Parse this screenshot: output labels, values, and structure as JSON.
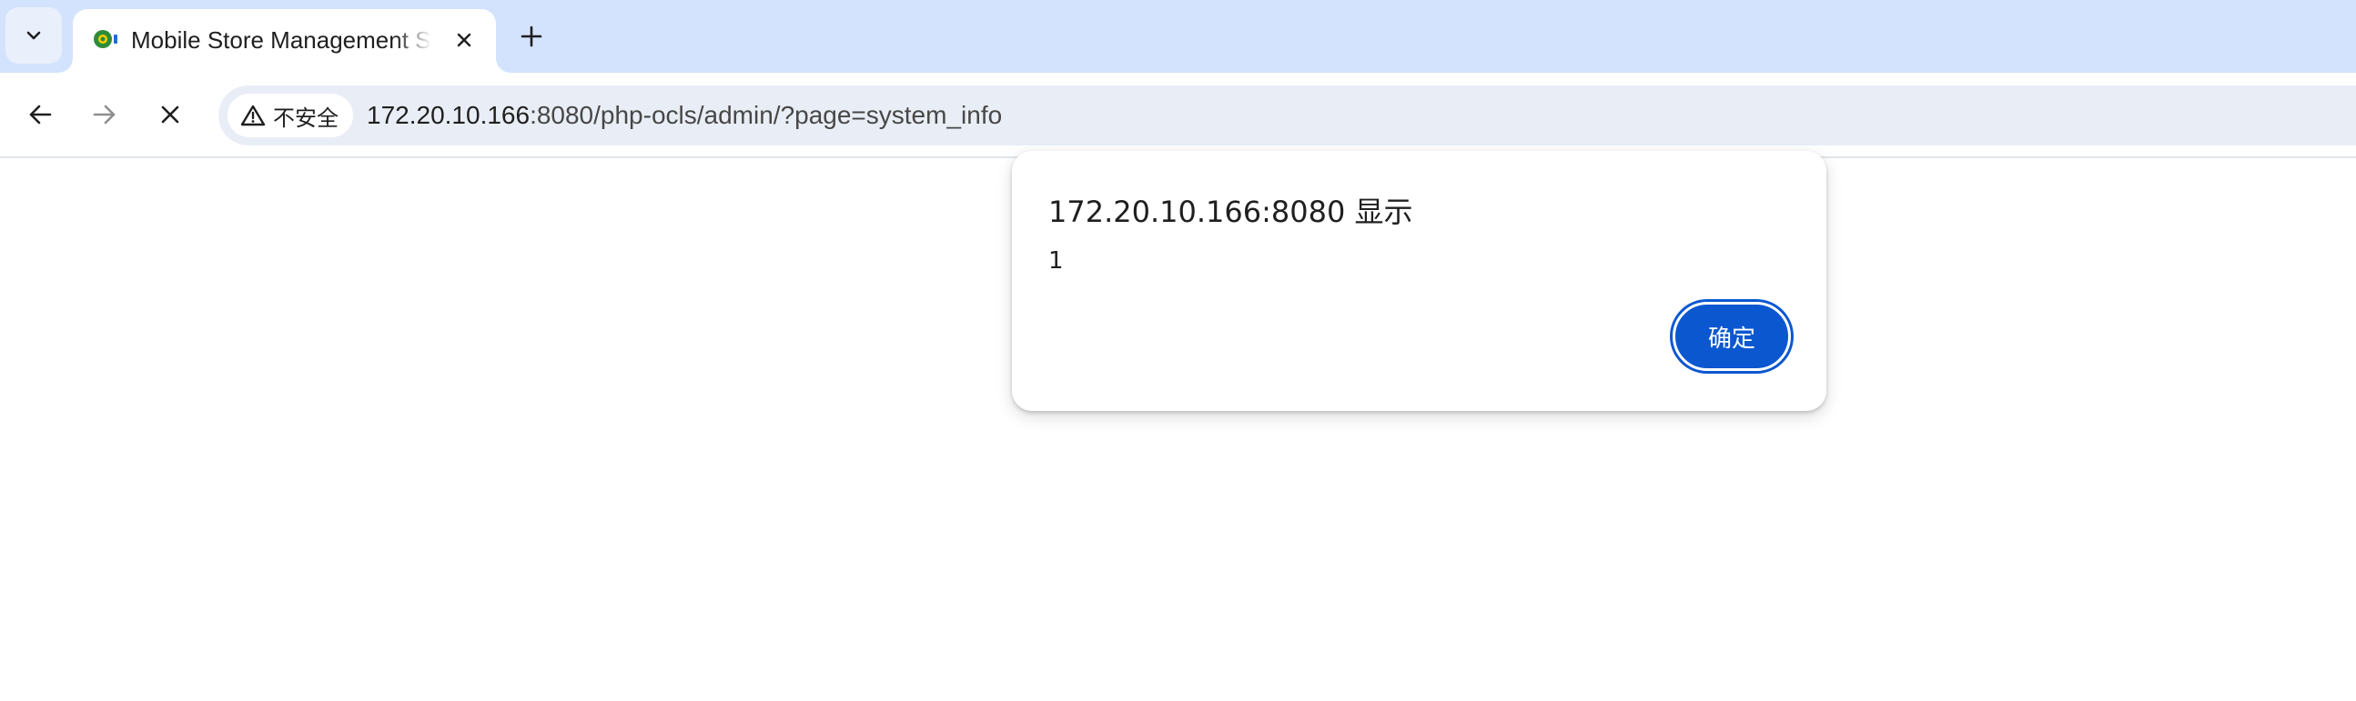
{
  "browser": {
    "tab": {
      "title": "Mobile Store Management System",
      "close_icon": "close-icon",
      "favicon": "site-favicon"
    },
    "icons": {
      "tab_search": "chevron-down-icon",
      "new_tab": "plus-icon",
      "back": "arrow-left-icon",
      "forward": "arrow-right-icon",
      "stop": "close-icon",
      "security": "warning-triangle-icon"
    },
    "security_label": "不安全",
    "url_host": "172.20.10.166",
    "url_rest": ":8080/php-ocls/admin/?page=system_info"
  },
  "dialog": {
    "title": "172.20.10.166:8080 显示",
    "message": "1",
    "ok_label": "确定"
  },
  "colors": {
    "tabstrip_bg": "#d3e3fd",
    "omnibox_bg": "#e9eef6",
    "primary_button": "#0b57d0"
  }
}
